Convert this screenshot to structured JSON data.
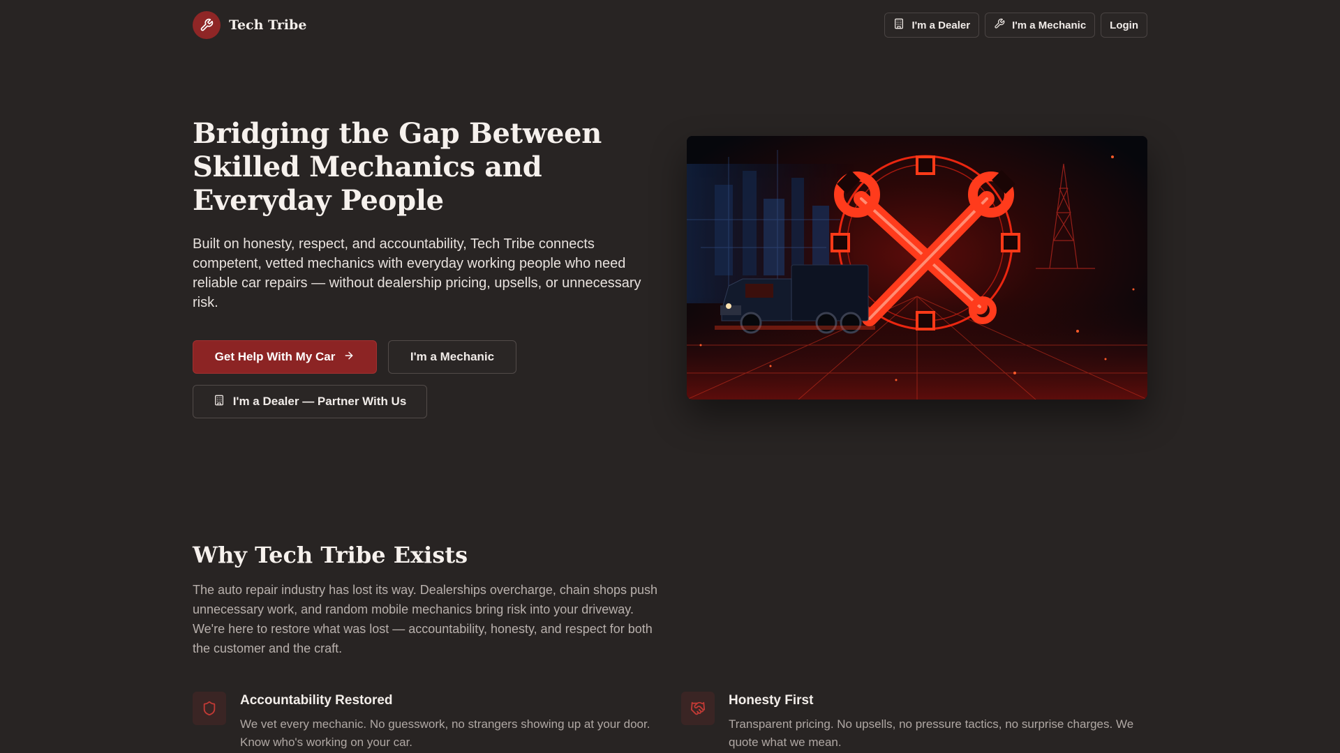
{
  "brand": {
    "name": "Tech Tribe",
    "accent": "#8c2424"
  },
  "nav": {
    "dealer_label": "I'm a Dealer",
    "mechanic_label": "I'm a Mechanic",
    "login_label": "Login"
  },
  "hero": {
    "title": "Bridging the Gap Between Skilled Mechanics and Everyday People",
    "subtitle": "Built on honesty, respect, and accountability, Tech Tribe connects competent, vetted mechanics with everyday working people who need reliable car repairs — without dealership pricing, upsells, or unnecessary risk.",
    "primary_cta": "Get Help With My Car",
    "mechanic_cta": "I'm a Mechanic",
    "dealer_cta": "I'm a Dealer — Partner With Us"
  },
  "why": {
    "title": "Why Tech Tribe Exists",
    "text": "The auto repair industry has lost its way. Dealerships overcharge, chain shops push unnecessary work, and random mobile mechanics bring risk into your driveway. We're here to restore what was lost — accountability, honesty, and respect for both the customer and the craft.",
    "features": [
      {
        "icon": "shield-icon",
        "title": "Accountability Restored",
        "desc": "We vet every mechanic. No guesswork, no strangers showing up at your door. Know who's working on your car."
      },
      {
        "icon": "handshake-icon",
        "title": "Honesty First",
        "desc": "Transparent pricing. No upsells, no pressure tactics, no surprise charges. We quote what we mean."
      }
    ]
  }
}
